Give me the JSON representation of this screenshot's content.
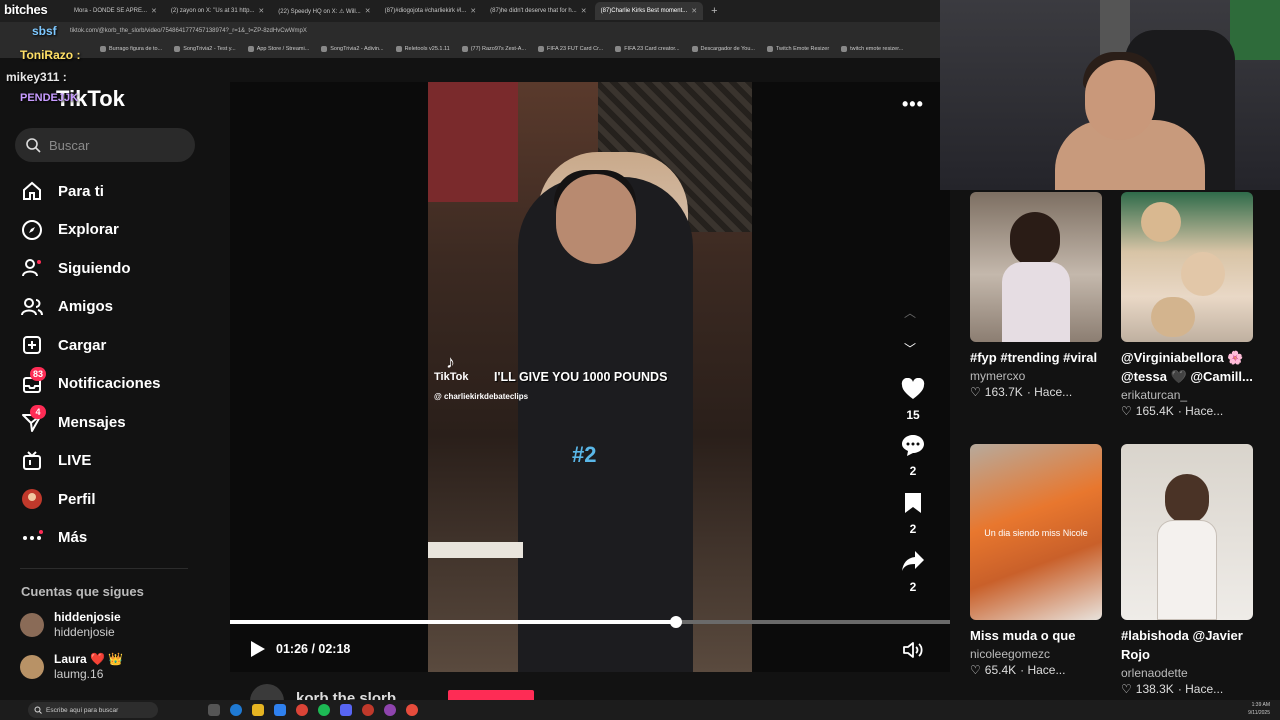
{
  "browser": {
    "tabs": [
      {
        "label": "Mora - DONDE SE APRE..."
      },
      {
        "label": "(2) zayon on X: \"Us at 31 http..."
      },
      {
        "label": "(22) Speedy HQ on X: ⚠ Will..."
      },
      {
        "label": "(87)#diogojota #charliekirk #l..."
      },
      {
        "label": "(87)he didn't deserve that for h..."
      },
      {
        "label": "(87)Charlie Kirks Best moment..."
      }
    ],
    "active_tab": 5,
    "url": "tiktok.com/@korb_the_slorb/video/7548641777457138974?_r=1&_t=ZP-8zdHvCwWmpX",
    "bookmarks": [
      "Burrago figura de to...",
      "SongTrivia2 - Test y...",
      "App Store / Streami...",
      "SongTrivia2 - Adivin...",
      "Reletools v25.1.11",
      "(77) Razo97s Zest-A...",
      "FIFA 23 FUT Card Cr...",
      "FIFA 23 Card creator...",
      "Descargador de You...",
      "Twitch Emote Resizer",
      "twitch emote resizer..."
    ]
  },
  "stream_overlay": {
    "brand": "bitches",
    "chat": [
      "sbsf",
      "ToniRazo :",
      "mikey311 :",
      "PENDEJJK"
    ]
  },
  "sidebar": {
    "logo": "TikTok",
    "search_placeholder": "Buscar",
    "nav": [
      {
        "label": "Para ti",
        "icon": "home-icon"
      },
      {
        "label": "Explorar",
        "icon": "compass-icon"
      },
      {
        "label": "Siguiendo",
        "icon": "following-icon"
      },
      {
        "label": "Amigos",
        "icon": "friends-icon"
      },
      {
        "label": "Cargar",
        "icon": "upload-icon"
      },
      {
        "label": "Notificaciones",
        "icon": "inbox-icon",
        "badge": "83"
      },
      {
        "label": "Mensajes",
        "icon": "send-icon",
        "badge": "4"
      },
      {
        "label": "LIVE",
        "icon": "live-icon"
      },
      {
        "label": "Perfil",
        "icon": "avatar-icon"
      },
      {
        "label": "Más",
        "icon": "more-icon"
      }
    ],
    "following_title": "Cuentas que sigues",
    "following": [
      {
        "name": "hiddenjosie",
        "handle": "hiddenjosie"
      },
      {
        "name": "Laura ❤️ 👑",
        "handle": "laumg.16"
      }
    ]
  },
  "video": {
    "watermark": "TikTok",
    "watermark_handle": "@ charliekirkdebateclips",
    "caption": "I'LL GIVE YOU 1000 POUNDS",
    "hashtag": "#2",
    "likes": "15",
    "comments": "2",
    "saves": "2",
    "shares": "2",
    "time": "01:26 / 02:18",
    "progress": 0.62,
    "author": "korb the slorb"
  },
  "recommended": [
    {
      "title": "#fyp #trending #viral",
      "author": "mymercxo",
      "views": "163.7K",
      "age": "· Hace...",
      "thumb_text": ""
    },
    {
      "title": "@Virginiabellora 🌸 @tessa 🖤 @Camill...",
      "author": "erikaturcan_",
      "views": "165.4K",
      "age": "· Hace...",
      "thumb_text": ""
    },
    {
      "title": "Miss muda o que",
      "author": "nicoleegomezc",
      "views": "65.4K",
      "age": "· Hace...",
      "thumb_text": "Un dia siendo miss Nicole"
    },
    {
      "title": "#labishoda @Javier Rojo",
      "author": "orlenaodette",
      "views": "138.3K",
      "age": "· Hace...",
      "thumb_text": ""
    }
  ],
  "taskbar": {
    "search_placeholder": "Escribe aquí para buscar",
    "time": "1:39 AM",
    "date": "9/11/2025"
  },
  "colors": {
    "accent": "#fe2c55",
    "hashtag": "#5ab7e8",
    "background": "#121212"
  }
}
